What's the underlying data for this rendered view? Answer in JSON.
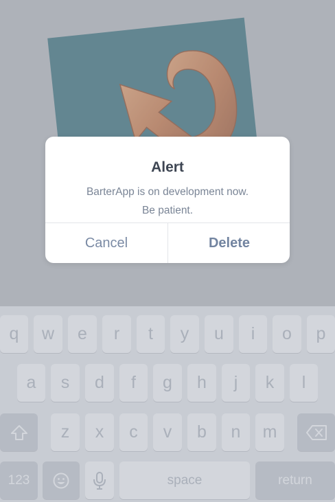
{
  "alert": {
    "title": "Alert",
    "message_line1": "BarterApp is on development now.",
    "message_line2": "Be patient.",
    "cancel_label": "Cancel",
    "delete_label": "Delete"
  },
  "keyboard": {
    "row1": [
      "q",
      "w",
      "e",
      "r",
      "t",
      "y",
      "u",
      "i",
      "o",
      "p"
    ],
    "row2": [
      "a",
      "s",
      "d",
      "f",
      "g",
      "h",
      "j",
      "k",
      "l"
    ],
    "row3": [
      "z",
      "x",
      "c",
      "v",
      "b",
      "n",
      "m"
    ],
    "numbers_label": "123",
    "space_label": "space",
    "return_label": "return"
  },
  "icons": {
    "shift": "shift-icon",
    "delete": "backspace-icon",
    "emoji": "emoji-icon",
    "mic": "microphone-icon"
  },
  "colors": {
    "photo_background": "#3b727f",
    "copper": "#c9784a",
    "alert_title": "#3d4552",
    "alert_text": "#7a8596",
    "button_text": "#7a8aa4"
  }
}
